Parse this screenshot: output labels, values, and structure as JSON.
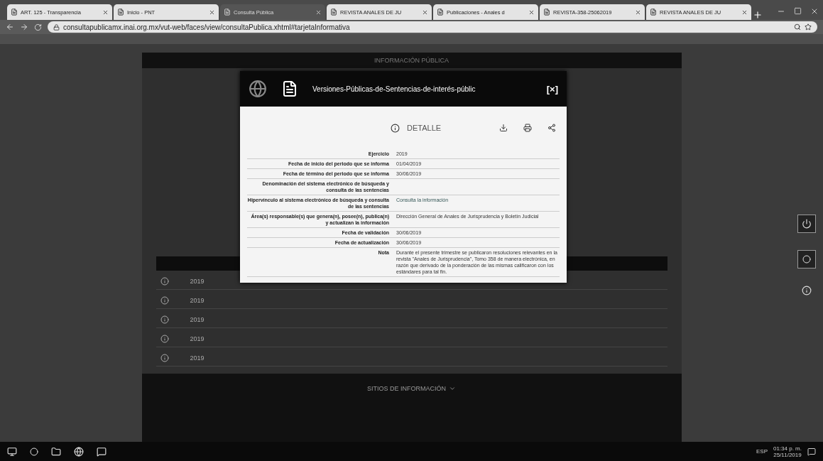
{
  "browser": {
    "tabs": [
      {
        "label": "ART. 125 - Transparencia",
        "selected": false
      },
      {
        "label": "Inicio - PNT",
        "selected": false
      },
      {
        "label": "Consulta Pública",
        "selected": true
      },
      {
        "label": "REVISTA ANALES DE JU",
        "selected": false
      },
      {
        "label": "Publicaciones - Anales d",
        "selected": false
      },
      {
        "label": "REVISTA-358-25062019",
        "selected": false
      },
      {
        "label": "REVISTA ANALES DE JU",
        "selected": false
      }
    ],
    "url": "consultapublicamx.inai.org.mx/vut-web/faces/view/consultaPublica.xhtml#tarjetaInformativa"
  },
  "page": {
    "header": "INFORMACIÓN PÚBLICA",
    "table": {
      "rows": [
        {
          "year": "2019"
        },
        {
          "year": "2019"
        },
        {
          "year": "2019"
        },
        {
          "year": "2019"
        },
        {
          "year": "2019"
        }
      ]
    },
    "footer": {
      "title": "SITIOS DE INFORMACIÓN"
    }
  },
  "modal": {
    "title": "Versiones-Públicas-de-Sentencias-de-interés-públic",
    "close": "[×]",
    "section": "DETALLE",
    "fields": [
      {
        "label": "Ejercicio",
        "value": "2019"
      },
      {
        "label": "Fecha de inicio del periodo que se informa",
        "value": "01/04/2019"
      },
      {
        "label": "Fecha de término del periodo que se informa",
        "value": "30/06/2019"
      },
      {
        "label": "Denominación del sistema electrónico de búsqueda y consulta de las sentencias"
      },
      {
        "label": "Hipervínculo al sistema electrónico de búsqueda y consulta de las sentencias",
        "value": "Consulta la información",
        "kind": "link"
      },
      {
        "label": "Área(s) responsable(s) que genera(n), posee(n), publica(n) y actualizan la información",
        "value": "Dirección General de Anales de Jurisprudencia y Boletín Judicial"
      },
      {
        "label": "Fecha de validación",
        "value": "30/06/2019"
      },
      {
        "label": "Fecha de actualización",
        "value": "30/06/2019"
      },
      {
        "label": "Nota",
        "value": "Durante el presente trimestre se publicaron resoluciones relevantes en la revista \"Anales de Jurisprudencia\", Tomo 358 de manera electrónica, en razón que derivado de la ponderación de las mismas calificaron con los estándares para tal fin."
      }
    ]
  },
  "taskbar": {
    "language": "ESP",
    "time": "01:34 p. m.",
    "date": "25/11/2019"
  }
}
